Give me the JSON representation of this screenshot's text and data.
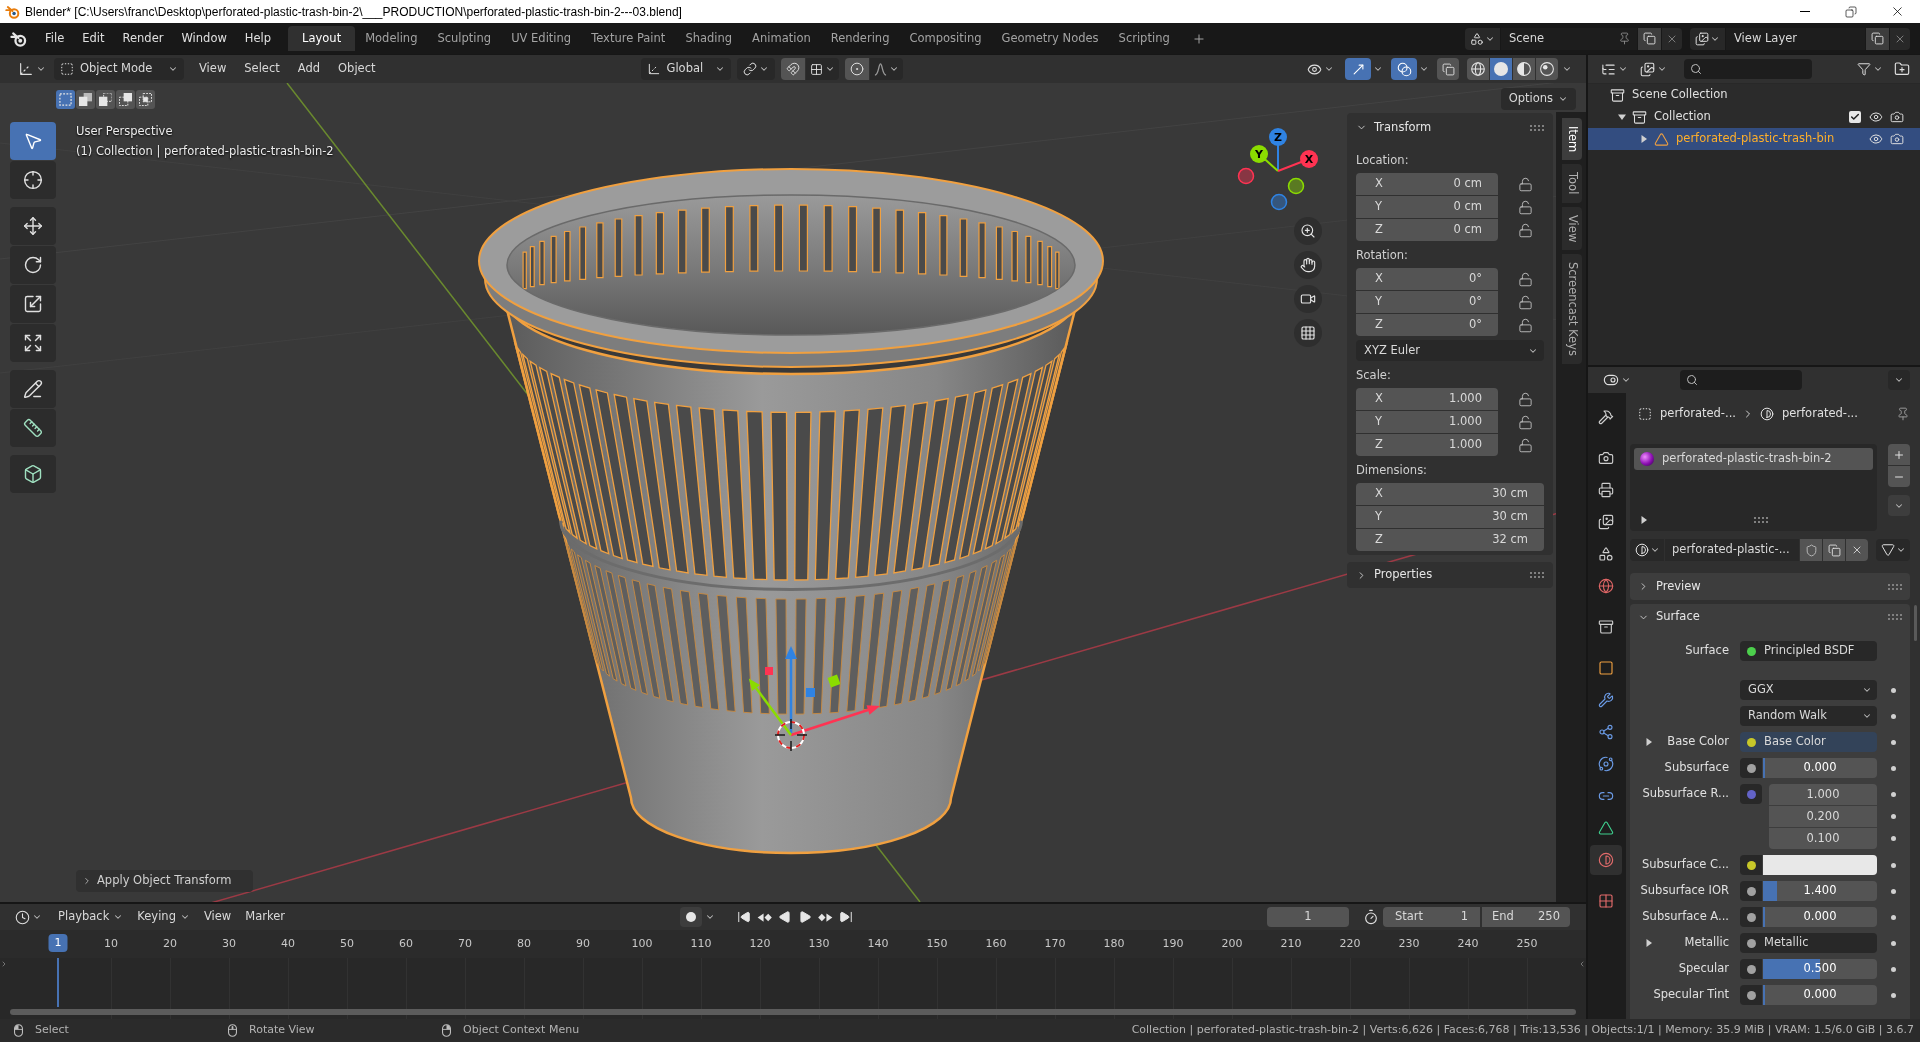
{
  "window": {
    "title": "Blender* [C:\\Users\\franc\\Desktop\\perforated-plastic-trash-bin-2\\___PRODUCTION\\perforated-plastic-trash-bin-2---03.blend]"
  },
  "menu": [
    "File",
    "Edit",
    "Render",
    "Window",
    "Help"
  ],
  "workspaces": [
    {
      "label": "Layout",
      "selected": true
    },
    {
      "label": "Modeling",
      "selected": false
    },
    {
      "label": "Sculpting",
      "selected": false
    },
    {
      "label": "UV Editing",
      "selected": false
    },
    {
      "label": "Texture Paint",
      "selected": false
    },
    {
      "label": "Shading",
      "selected": false
    },
    {
      "label": "Animation",
      "selected": false
    },
    {
      "label": "Rendering",
      "selected": false
    },
    {
      "label": "Compositing",
      "selected": false
    },
    {
      "label": "Geometry Nodes",
      "selected": false
    },
    {
      "label": "Scripting",
      "selected": false
    }
  ],
  "scene": {
    "name": "Scene"
  },
  "view_layer": {
    "name": "View Layer"
  },
  "viewport": {
    "mode": "Object Mode",
    "menus": [
      "View",
      "Select",
      "Add",
      "Object"
    ],
    "orientation": "Global",
    "gizmos_on": true,
    "overlays_on": true,
    "xray_on": false,
    "shading": [
      {
        "kind": "wireframe",
        "selected": false
      },
      {
        "kind": "solid",
        "selected": true
      },
      {
        "kind": "material",
        "selected": false
      },
      {
        "kind": "rendered",
        "selected": false
      }
    ],
    "select_modes": [
      {
        "kind": "set",
        "selected": true
      },
      {
        "kind": "extend",
        "selected": false
      },
      {
        "kind": "subtract",
        "selected": false
      },
      {
        "kind": "invert",
        "selected": false
      },
      {
        "kind": "intersect",
        "selected": false
      }
    ],
    "options": "Options",
    "view_name": "User Perspective",
    "context": "(1) Collection | perforated-plastic-trash-bin-2",
    "tools": [
      {
        "kind": "select_box",
        "selected": true
      },
      {
        "kind": "cursor",
        "selected": false
      },
      {
        "kind": "move",
        "selected": false
      },
      {
        "kind": "rotate",
        "selected": false
      },
      {
        "kind": "scale",
        "selected": false
      },
      {
        "kind": "transform",
        "selected": false
      },
      {
        "kind": "annotate",
        "selected": false
      },
      {
        "kind": "measure",
        "selected": false
      },
      {
        "kind": "add_cube",
        "selected": false
      }
    ],
    "nav_axes": [
      {
        "label": "Z",
        "color": "#2f83e3"
      },
      {
        "label": "Y",
        "color": "#8bdc00"
      },
      {
        "label": "X",
        "color": "#ff3352"
      }
    ],
    "last_operator": {
      "label": "Apply Object Transform",
      "expanded": false
    },
    "sidebar_tabs": [
      {
        "label": "Item",
        "selected": true
      },
      {
        "label": "Tool",
        "selected": false
      },
      {
        "label": "View",
        "selected": false
      },
      {
        "label": "Screencast Keys",
        "selected": false
      }
    ],
    "transform": {
      "title": "Transform",
      "expanded": true,
      "sections": [
        {
          "kind": "vector",
          "label": "Location:",
          "rows": [
            {
              "axis": "X",
              "value": "0 cm",
              "locked": false
            },
            {
              "axis": "Y",
              "value": "0 cm",
              "locked": false
            },
            {
              "axis": "Z",
              "value": "0 cm",
              "locked": false
            }
          ]
        },
        {
          "kind": "vector",
          "label": "Rotation:",
          "rows": [
            {
              "axis": "X",
              "value": "0°",
              "locked": false
            },
            {
              "axis": "Y",
              "value": "0°",
              "locked": false
            },
            {
              "axis": "Z",
              "value": "0°",
              "locked": false
            }
          ]
        },
        {
          "kind": "dropdown",
          "value": "XYZ Euler"
        },
        {
          "kind": "vector",
          "label": "Scale:",
          "rows": [
            {
              "axis": "X",
              "value": "1.000",
              "locked": false
            },
            {
              "axis": "Y",
              "value": "1.000",
              "locked": false
            },
            {
              "axis": "Z",
              "value": "1.000",
              "locked": false
            }
          ]
        },
        {
          "kind": "vector",
          "label": "Dimensions:",
          "rows": [
            {
              "axis": "X",
              "value": "30 cm"
            },
            {
              "axis": "Y",
              "value": "30 cm"
            },
            {
              "axis": "Z",
              "value": "32 cm"
            }
          ]
        }
      ]
    },
    "properties_panel": {
      "title": "Properties",
      "expanded": false
    }
  },
  "outliner": {
    "items": [
      {
        "kind": "scene_collection",
        "label": "Scene Collection",
        "selected": false,
        "children": [
          {
            "kind": "collection",
            "label": "Collection",
            "expanded": true,
            "checked": true,
            "selected": false,
            "children": [
              {
                "kind": "mesh",
                "label": "perforated-plastic-trash-bin",
                "expanded": false,
                "selected": true
              }
            ]
          }
        ]
      }
    ]
  },
  "properties": {
    "tabs": [
      {
        "kind": "tool",
        "selected": false
      },
      {
        "kind": "render",
        "selected": false
      },
      {
        "kind": "output",
        "selected": false
      },
      {
        "kind": "view_layer",
        "selected": false
      },
      {
        "kind": "scene",
        "selected": false
      },
      {
        "kind": "world",
        "selected": false
      },
      {
        "kind": "collection",
        "selected": false
      },
      {
        "kind": "object",
        "selected": false
      },
      {
        "kind": "modifiers",
        "selected": false
      },
      {
        "kind": "particles",
        "selected": false
      },
      {
        "kind": "physics",
        "selected": false
      },
      {
        "kind": "constraints",
        "selected": false
      },
      {
        "kind": "data",
        "selected": false
      },
      {
        "kind": "material",
        "selected": true
      },
      {
        "kind": "texture",
        "selected": false
      }
    ],
    "breadcrumb": [
      {
        "kind": "object",
        "label": "perforated-..."
      },
      {
        "kind": "material",
        "label": "perforated-..."
      }
    ],
    "material_slots": [
      {
        "label": "perforated-plastic-trash-bin-2",
        "selected": true
      }
    ],
    "material": {
      "name": "perforated-plastic-..."
    },
    "preview": {
      "title": "Preview",
      "expanded": false
    },
    "surface_panel": {
      "title": "Surface",
      "expanded": true
    },
    "surface": {
      "label": "Surface",
      "shader": "Principled BSDF",
      "color": "#4ccf4c"
    },
    "rows": [
      {
        "kind": "dropdown",
        "value": "GGX"
      },
      {
        "kind": "dropdown",
        "value": "Random Walk"
      },
      {
        "kind": "link",
        "label": "Base Color",
        "value": "Base Color",
        "color": "#c7c729",
        "expanded": false,
        "highlighted": true
      },
      {
        "kind": "slider",
        "label": "Subsurface",
        "value": "0.000",
        "level": 0,
        "color": "#a1a1a1"
      },
      {
        "kind": "vector",
        "label": "Subsurface R...",
        "values": [
          "1.000",
          "0.200",
          "0.100"
        ],
        "color": "#6363c7"
      },
      {
        "kind": "color",
        "label": "Subsurface C...",
        "color": "#c7c729",
        "swatch": {
          "color": "#e8e8e8"
        }
      },
      {
        "kind": "slider",
        "label": "Subsurface IOR",
        "value": "1.400",
        "level": 0.12,
        "color": "#a1a1a1"
      },
      {
        "kind": "slider",
        "label": "Subsurface A...",
        "value": "0.000",
        "level": 0,
        "color": "#a1a1a1"
      },
      {
        "kind": "link",
        "label": "Metallic",
        "value": "Metallic",
        "color": "#a1a1a1",
        "expanded": false,
        "highlighted": false
      },
      {
        "kind": "slider",
        "label": "Specular",
        "value": "0.500",
        "level": 0.5,
        "color": "#a1a1a1"
      },
      {
        "kind": "slider",
        "label": "Specular Tint",
        "value": "0.000",
        "level": 0,
        "color": "#a1a1a1"
      }
    ]
  },
  "timeline": {
    "menus": [
      {
        "label": "Playback",
        "dropdown": true
      },
      {
        "label": "Keying",
        "dropdown": true
      },
      {
        "label": "View",
        "dropdown": false
      },
      {
        "label": "Marker",
        "dropdown": false
      }
    ],
    "current_frame": "1",
    "start_label": "Start",
    "start": "1",
    "end_label": "End",
    "end": "250",
    "playhead": "1",
    "ticks": [
      "10",
      "20",
      "30",
      "40",
      "50",
      "60",
      "70",
      "80",
      "90",
      "100",
      "110",
      "120",
      "130",
      "140",
      "150",
      "160",
      "170",
      "180",
      "190",
      "200",
      "210",
      "220",
      "230",
      "240",
      "250"
    ]
  },
  "status_bar": {
    "hints": [
      {
        "kind": "left",
        "label": "Select"
      },
      {
        "kind": "middle",
        "label": "Rotate View"
      },
      {
        "kind": "right",
        "label": "Object Context Menu"
      }
    ],
    "stats": "Collection | perforated-plastic-trash-bin-2 | Verts:6,626 | Faces:6,768 | Tris:13,536 | Objects:1/1 | Memory: 35.9 MiB | VRAM: 1.5/6.0 GiB | 3.6.7"
  }
}
